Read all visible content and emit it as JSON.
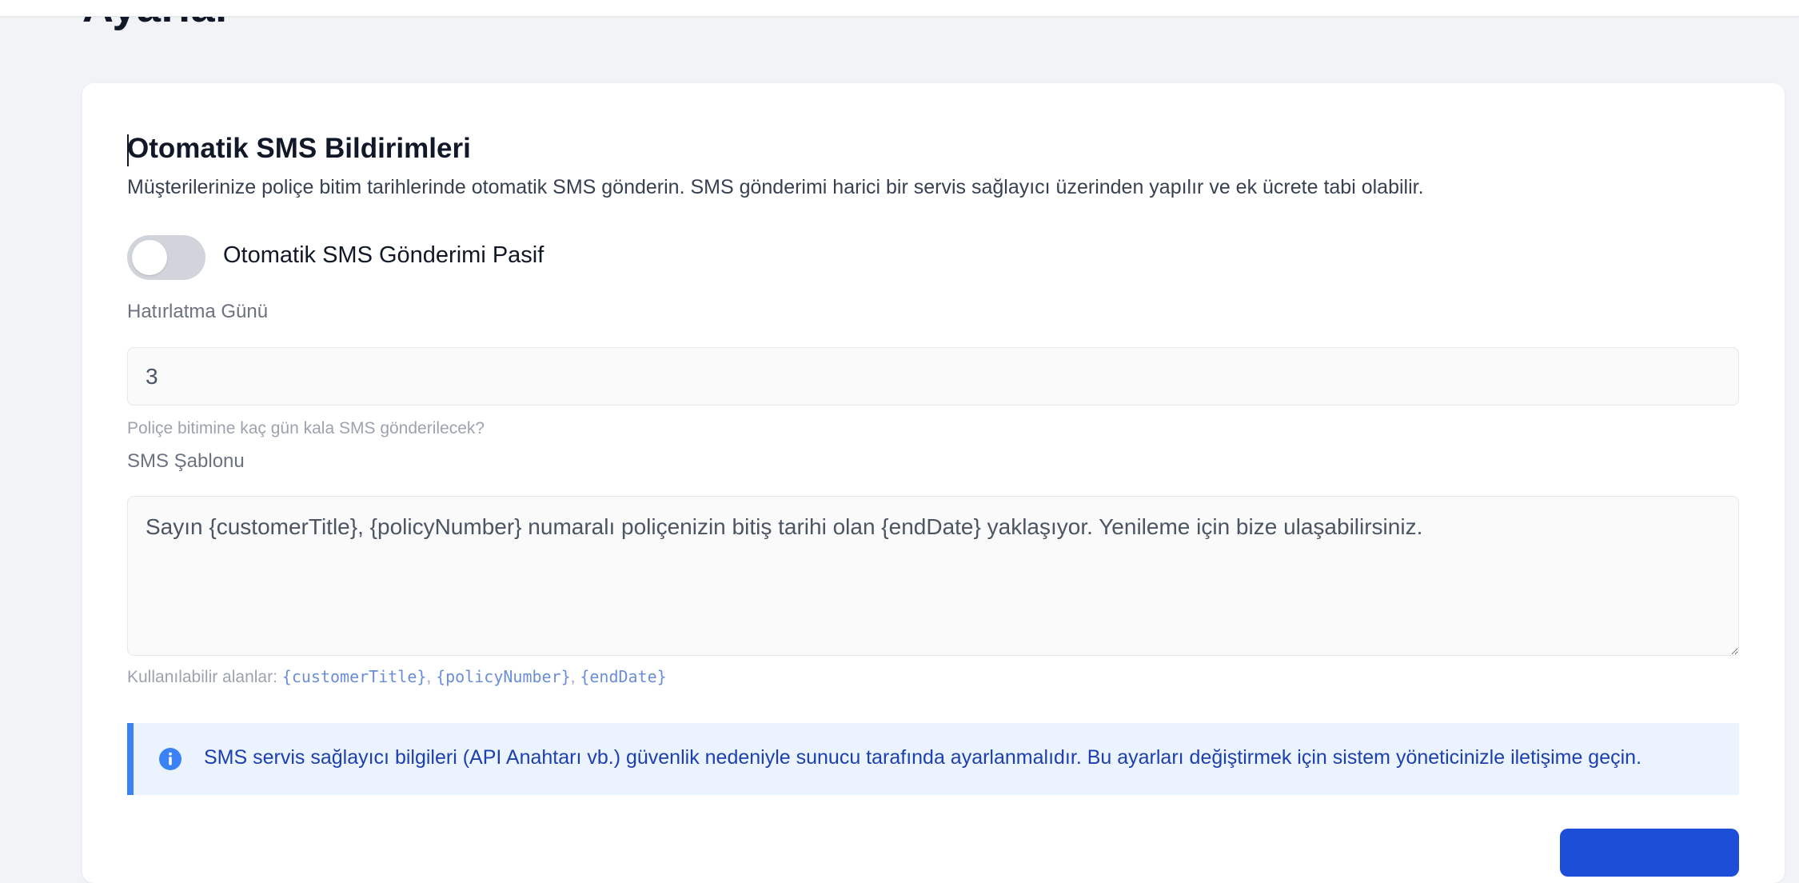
{
  "page": {
    "title": "Ayarlar"
  },
  "sms_settings": {
    "title": "Otomatik SMS Bildirimleri",
    "description": "Müşterilerinize poliçe bitim tarihlerinde otomatik SMS gönderin. SMS gönderimi harici bir servis sağlayıcı üzerinden yapılır ve ek ücrete tabi olabilir.",
    "toggle": {
      "enabled": false,
      "label": "Otomatik SMS Gönderimi Pasif"
    },
    "reminder_day": {
      "label": "Hatırlatma Günü",
      "value": "3",
      "help": "Poliçe bitimine kaç gün kala SMS gönderilecek?"
    },
    "template": {
      "label": "SMS Şablonu",
      "value": "Sayın {customerTitle}, {policyNumber} numaralı poliçenizin bitiş tarihi olan {endDate} yaklaşıyor. Yenileme için bize ulaşabilirsiniz.",
      "fields_label": "Kullanılabilir alanlar:",
      "fields": [
        "{customerTitle}",
        "{policyNumber}",
        "{endDate}"
      ]
    },
    "info": {
      "icon": "info-icon",
      "text": "SMS servis sağlayıcı bilgileri (API Anahtarı vb.) güvenlik nedeniyle sunucu tarafında ayarlanmalıdır. Bu ayarları değiştirmek için sistem yöneticinizle iletişime geçin."
    }
  },
  "colors": {
    "accent": "#1d4ed8",
    "info_border": "#3b82f6",
    "info_bg": "#ebf3fe",
    "info_text": "#1e40af",
    "toggle_off": "#d1d5db"
  }
}
